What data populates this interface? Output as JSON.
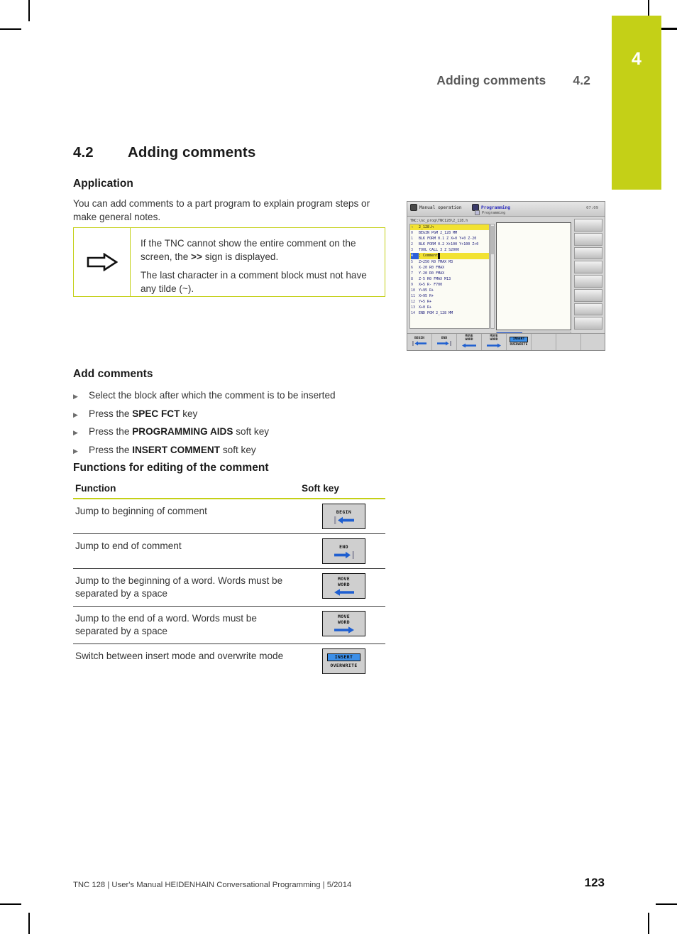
{
  "chapter_tab": {
    "number": "4",
    "color": "#c4d017"
  },
  "running_head": {
    "title": "Adding comments",
    "section": "4.2"
  },
  "page": {
    "number": "4.2",
    "title": "Adding comments"
  },
  "application": {
    "heading": "Application",
    "body": "You can add comments to a part program to explain program steps or make general notes."
  },
  "note": {
    "icon": "arrow-right-outline-icon",
    "line1_pre": "If the TNC cannot show the entire comment on the screen, the ",
    "line1_bold": ">>",
    "line1_post": " sign is displayed.",
    "line2": "The last character in a comment block must not have any tilde (~)."
  },
  "add_comments": {
    "heading": "Add comments",
    "steps": [
      {
        "pre": "Select the block after which the comment is to be inserted",
        "bold": "",
        "post": ""
      },
      {
        "pre": "Press the ",
        "bold": "SPEC FCT",
        "post": " key"
      },
      {
        "pre": "Press the ",
        "bold": "PROGRAMMING AIDS",
        "post": " soft key"
      },
      {
        "pre": "Press the ",
        "bold": "INSERT COMMENT",
        "post": " soft key"
      }
    ]
  },
  "functions_table": {
    "heading": "Functions for editing of the comment",
    "columns": {
      "function": "Function",
      "softkey": "Soft key"
    },
    "rows": [
      {
        "function": "Jump to beginning of comment",
        "softkey": {
          "type": "arrow",
          "lines": [
            "BEGIN"
          ],
          "arrow": "bar-left",
          "name": "softkey-begin"
        }
      },
      {
        "function": "Jump to end of comment",
        "softkey": {
          "type": "arrow",
          "lines": [
            "END"
          ],
          "arrow": "right-bar",
          "name": "softkey-end"
        }
      },
      {
        "function": "Jump to the beginning of a word. Words must be separated by a space",
        "softkey": {
          "type": "arrow",
          "lines": [
            "MOVE",
            "WORD"
          ],
          "arrow": "left",
          "name": "softkey-move-word-left"
        }
      },
      {
        "function": "Jump to the end of a word. Words must be separated by a space",
        "softkey": {
          "type": "arrow",
          "lines": [
            "MOVE",
            "WORD"
          ],
          "arrow": "right",
          "name": "softkey-move-word-right"
        }
      },
      {
        "function": "Switch between insert mode and overwrite mode",
        "softkey": {
          "type": "toggle",
          "highlighted": "INSERT",
          "second": "OVERWRITE",
          "name": "softkey-insert-overwrite"
        }
      }
    ]
  },
  "tnc_screen": {
    "mode_left": "Manual operation",
    "mode_right": "Programming",
    "sub_mode": "Programming",
    "clock": "07:09",
    "path": "TNC:\\nc_prog\\TNC128\\2_128.h",
    "program_title": "2_128.h",
    "program_lines": [
      {
        "no": "0",
        "text": "BEGIN PGM 2_128 MM"
      },
      {
        "no": "1",
        "text": "BLK FORM 0.1 Z X+0 Y+0 Z-20"
      },
      {
        "no": "2",
        "text": "BLK FORM 0.2  X+100  Y+100  Z+0"
      },
      {
        "no": "3",
        "text": "TOOL CALL 3 Z S2000"
      },
      {
        "no": "4",
        "text": "; Comment",
        "selected": true
      },
      {
        "no": "5",
        "text": "Z+250 R0 FMAX M3"
      },
      {
        "no": "6",
        "text": "X-20 R0 FMAX"
      },
      {
        "no": "7",
        "text": "Y-20 R0 FMAX"
      },
      {
        "no": "8",
        "text": "Z-5 R0 FMAX M13"
      },
      {
        "no": "9",
        "text": "X+5 R- F700"
      },
      {
        "no": "10",
        "text": "Y+95 R+"
      },
      {
        "no": "11",
        "text": "X+95 R+"
      },
      {
        "no": "12",
        "text": "Y+5 R+"
      },
      {
        "no": "13",
        "text": "X+0 R+"
      },
      {
        "no": "14",
        "text": "END PGM 2_128 MM"
      }
    ],
    "bottom_softkeys": [
      {
        "lines": [
          "BEGIN"
        ],
        "arrow": "bar-left"
      },
      {
        "lines": [
          "END"
        ],
        "arrow": "right-bar"
      },
      {
        "lines": [
          "MOVE",
          "WORD"
        ],
        "arrow": "left"
      },
      {
        "lines": [
          "MOVE",
          "WORD"
        ],
        "arrow": "right"
      },
      {
        "type": "toggle",
        "highlighted": "INSERT",
        "second": "OVERWRITE"
      },
      {
        "lines": [
          ""
        ],
        "arrow": ""
      },
      {
        "lines": [
          ""
        ],
        "arrow": ""
      },
      {
        "lines": [
          ""
        ],
        "arrow": ""
      }
    ]
  },
  "footer": {
    "text": "TNC 128 | User's Manual HEIDENHAIN Conversational Programming | 5/2014",
    "page_number": "123"
  }
}
